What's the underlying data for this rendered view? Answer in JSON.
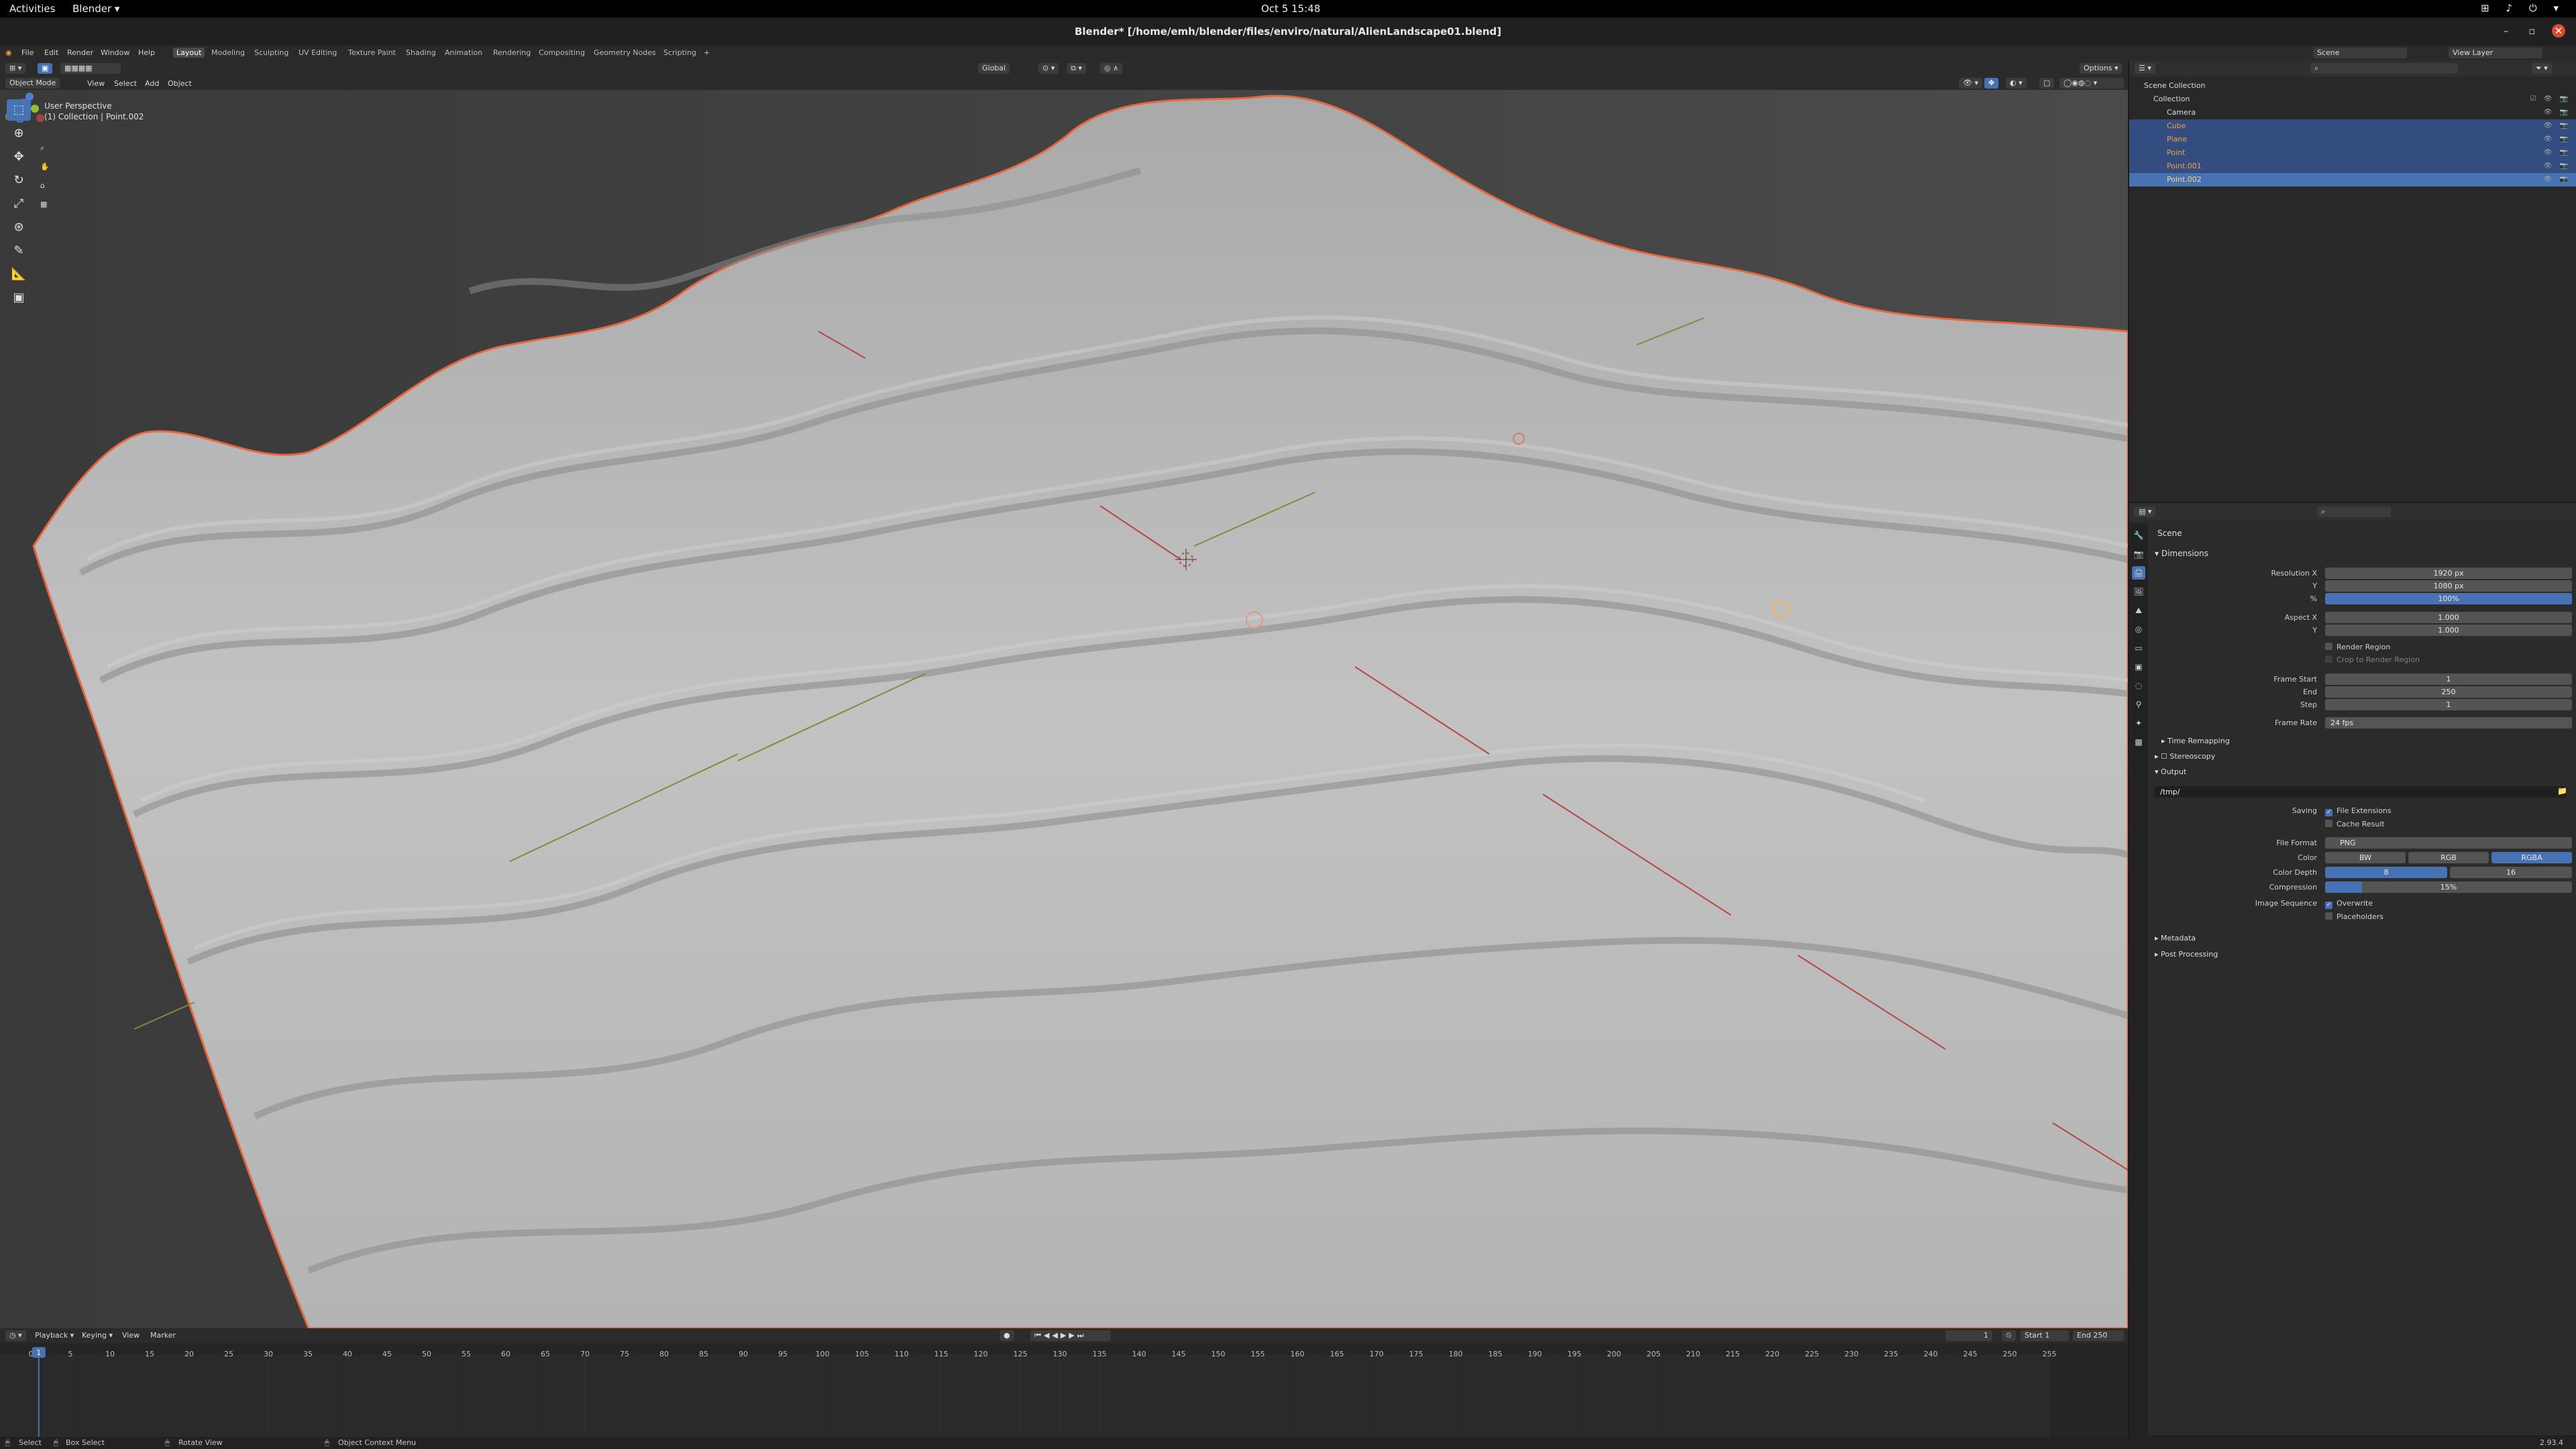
{
  "gnome": {
    "activities": "Activities",
    "app": "Blender ▾",
    "clock": "Oct 5  15:48",
    "tray": "⊞ ♪ ⏻ ▾"
  },
  "window": {
    "title": "Blender* [/home/emh/blender/files/enviro/natural/AlienLandscape01.blend]",
    "minimize": "–",
    "maximize": "▫",
    "close": "✕"
  },
  "menu": {
    "items": [
      "File",
      "Edit",
      "Render",
      "Window",
      "Help"
    ]
  },
  "workspaces": [
    "Layout",
    "Modeling",
    "Sculpting",
    "UV Editing",
    "Texture Paint",
    "Shading",
    "Animation",
    "Rendering",
    "Compositing",
    "Geometry Nodes",
    "Scripting",
    "+"
  ],
  "header_right": {
    "scene": "Scene",
    "view_layer": "View Layer"
  },
  "viewport_header": {
    "mode": "Object Mode",
    "menus": [
      "View",
      "Select",
      "Add",
      "Object"
    ],
    "transform": "Global",
    "options": "Options ▾"
  },
  "viewport": {
    "view_name": "User Perspective",
    "collection_line": "(1) Collection | Point.002"
  },
  "toolbar": [
    "select-box",
    "cursor",
    "move",
    "rotate",
    "scale",
    "transform",
    "annotate",
    "measure",
    "add-cube"
  ],
  "outliner": {
    "search_placeholder": "",
    "root": "Scene Collection",
    "collection": "Collection",
    "objects": [
      {
        "name": "Camera",
        "selected": false,
        "color": "#e0e0e0"
      },
      {
        "name": "Cube",
        "selected": true,
        "color": "#f0a040"
      },
      {
        "name": "Plane",
        "selected": true,
        "color": "#f0a040"
      },
      {
        "name": "Point",
        "selected": true,
        "color": "#f0a040"
      },
      {
        "name": "Point.001",
        "selected": true,
        "color": "#f0a040"
      },
      {
        "name": "Point.002",
        "selected": true,
        "color": "#ffd17a"
      }
    ]
  },
  "properties": {
    "breadcrumb": "Scene",
    "dimensions": {
      "section": "Dimensions",
      "resolution_x_label": "Resolution X",
      "resolution_x": "1920 px",
      "y_label": "Y",
      "resolution_y": "1080 px",
      "percent_label": "%",
      "percent": "100%",
      "aspect_x_label": "Aspect X",
      "aspect_x": "1.000",
      "aspect_y_label": "Y",
      "aspect_y": "1.000",
      "render_region": "Render Region",
      "crop": "Crop to Render Region",
      "frame_start_label": "Frame Start",
      "frame_start": "1",
      "end_label": "End",
      "end": "250",
      "step_label": "Step",
      "step": "1",
      "frame_rate_label": "Frame Rate",
      "frame_rate": "24 fps"
    },
    "time_remapping": "Time Remapping",
    "stereoscopy": "Stereoscopy",
    "output": {
      "section": "Output",
      "path": "/tmp/",
      "saving_label": "Saving",
      "file_extensions": "File Extensions",
      "cache_result": "Cache Result",
      "file_format_label": "File Format",
      "file_format": "PNG",
      "color_label": "Color",
      "color_options": [
        "BW",
        "RGB",
        "RGBA"
      ],
      "color_depth_label": "Color Depth",
      "color_depth_options": [
        "8",
        "16"
      ],
      "compression_label": "Compression",
      "compression": "15%",
      "compression_level": 0.15,
      "image_sequence_label": "Image Sequence",
      "overwrite": "Overwrite",
      "placeholders": "Placeholders"
    },
    "metadata": "Metadata",
    "post_processing": "Post Processing"
  },
  "timeline": {
    "menus": [
      "Playback ▾",
      "Keying ▾",
      "View",
      "Marker"
    ],
    "current_frame": "1",
    "start_label": "Start",
    "start": "1",
    "end_label": "End",
    "end": "250",
    "ruler": [
      "0",
      "5",
      "10",
      "15",
      "20",
      "25",
      "30",
      "35",
      "40",
      "45",
      "50",
      "55",
      "60",
      "65",
      "70",
      "75",
      "80",
      "85",
      "90",
      "95",
      "100",
      "105",
      "110",
      "115",
      "120",
      "125",
      "130",
      "135",
      "140",
      "145",
      "150",
      "155",
      "160",
      "165",
      "170",
      "175",
      "180",
      "185",
      "190",
      "195",
      "200",
      "205",
      "210",
      "215",
      "220",
      "225",
      "230",
      "235",
      "240",
      "245",
      "250",
      "255"
    ],
    "playhead": "1"
  },
  "status": {
    "select": "Select",
    "box_select": "Box Select",
    "rotate_view": "Rotate View",
    "context_menu": "Object Context Menu",
    "version": "2.93.4"
  },
  "colors": {
    "accent": "#4772b3",
    "selected_row": "#334d80",
    "orange_outline": "#e8663c"
  }
}
